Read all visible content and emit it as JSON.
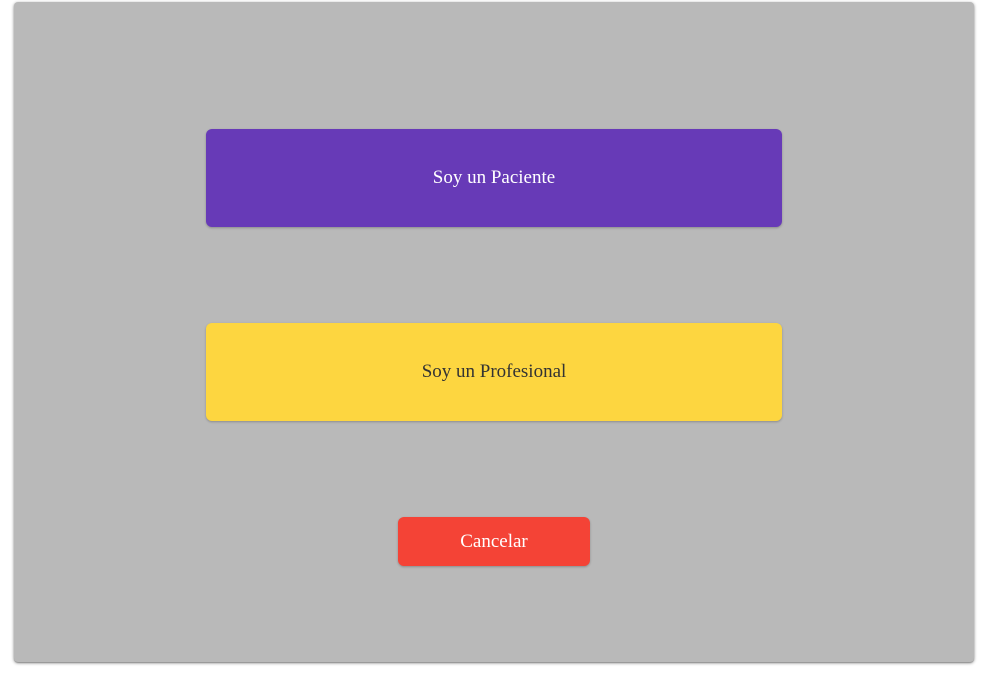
{
  "dialog": {
    "patient_button": {
      "label": "Soy un Paciente",
      "color": "#673ab7"
    },
    "professional_button": {
      "label": "Soy un Profesional",
      "color": "#fdd640"
    },
    "cancel_button": {
      "label": "Cancelar",
      "color": "#f44336"
    }
  },
  "colors": {
    "overlay_background": "#b9b9b9",
    "page_background": "#ffffff"
  }
}
